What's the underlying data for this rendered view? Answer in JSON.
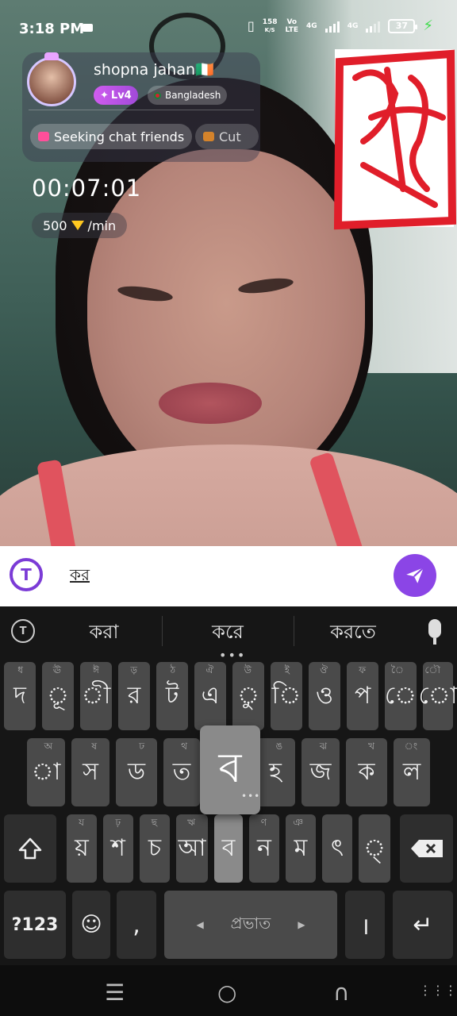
{
  "status_bar": {
    "time": "3:18 PM",
    "net_speed": "158",
    "net_unit": "K/S",
    "volte_top": "Vo",
    "volte_bottom": "LTE",
    "lte1": "4G",
    "lte2": "4G",
    "battery": "37"
  },
  "profile": {
    "name": "shopna jahan🇮🇪",
    "level": "Lv4",
    "country": "Bangladesh",
    "tags": [
      "Seeking chat friends",
      "Cut"
    ]
  },
  "call": {
    "timer": "00:07:01",
    "rate_amount": "500",
    "rate_unit": "/min"
  },
  "input": {
    "text": "কর",
    "logo_letter": "T"
  },
  "keyboard": {
    "suggestions": [
      "করা",
      "করে",
      "করতে"
    ],
    "row1": [
      {
        "key": "দ",
        "hint": "ধ"
      },
      {
        "key": "ূ",
        "hint": "ঊ"
      },
      {
        "key": "ী",
        "hint": "ঈ"
      },
      {
        "key": "র",
        "hint": "ড়"
      },
      {
        "key": "ট",
        "hint": "ঠ"
      },
      {
        "key": "এ",
        "hint": "ঐ"
      },
      {
        "key": "ু",
        "hint": "উ"
      },
      {
        "key": "ি",
        "hint": "ই"
      },
      {
        "key": "ও",
        "hint": "ঔ"
      },
      {
        "key": "প",
        "hint": "ফ"
      },
      {
        "key": "ে",
        "hint": "ৈ"
      },
      {
        "key": "ো",
        "hint": "ৌ"
      }
    ],
    "row2": [
      {
        "key": "া",
        "hint": "অ"
      },
      {
        "key": "স",
        "hint": "ষ"
      },
      {
        "key": "ড",
        "hint": "ঢ"
      },
      {
        "key": "ত",
        "hint": "থ"
      },
      {
        "key": "ব",
        "hint": ""
      },
      {
        "key": "হ",
        "hint": "ঙ"
      },
      {
        "key": "জ",
        "hint": "ঝ"
      },
      {
        "key": "ক",
        "hint": "খ"
      },
      {
        "key": "ল",
        "hint": "ং"
      }
    ],
    "row3": [
      {
        "key": "য়",
        "hint": "য"
      },
      {
        "key": "শ",
        "hint": "ঢ়"
      },
      {
        "key": "চ",
        "hint": "ছ"
      },
      {
        "key": "আ",
        "hint": "ঋ"
      },
      {
        "key": "ব",
        "hint": "ভ"
      },
      {
        "key": "ন",
        "hint": "ণ"
      },
      {
        "key": "ম",
        "hint": "ঞ"
      },
      {
        "key": "ৎ",
        "hint": ""
      },
      {
        "key": "্",
        "hint": ""
      }
    ],
    "symbols_label": "?123",
    "comma": ",",
    "space_label": "প্রভাত",
    "period": "।",
    "popup_key": "ব"
  },
  "nav": {
    "recents": "☰",
    "home": "○",
    "back": "∩",
    "keyboard_grid": "⋮⋮⋮"
  },
  "colors": {
    "accent": "#8b45e6",
    "level_badge": "#c058ec",
    "keyboard_bg": "#161616",
    "key_bg": "#4a4a4a"
  }
}
